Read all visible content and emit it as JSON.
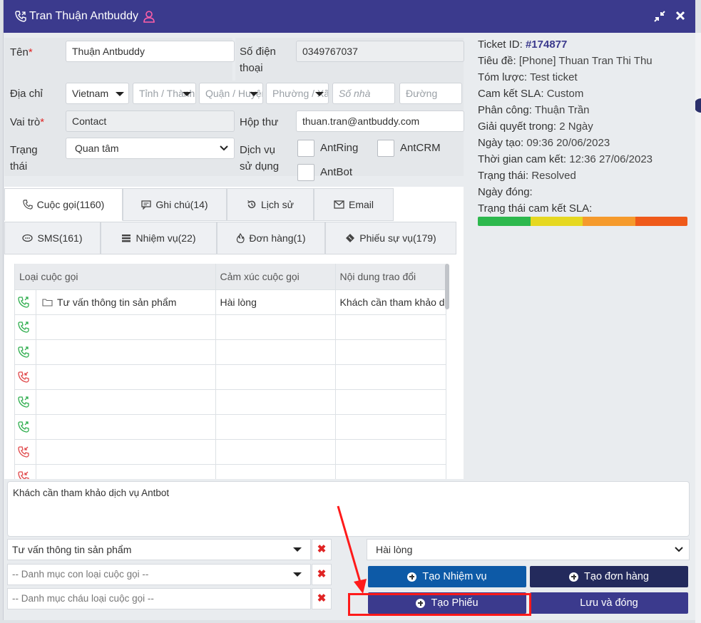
{
  "window": {
    "title": "Tran Thuận Antbuddy",
    "phone_icon": "phone-icon",
    "user_icon": "user-icon",
    "minimize_icon": "compress-icon",
    "close_icon": "close-icon"
  },
  "form": {
    "name_label": "Tên",
    "name_value": "Thuận  Antbuddy",
    "phone_label": "Số điện thoại",
    "phone_value": "0349767037",
    "address_label": "Địa chỉ",
    "country_value": "Vietnam",
    "province_placeholder": "Tỉnh / Thành phố",
    "district_placeholder": "Quận / Huyện",
    "ward_placeholder": "Phường / Xã",
    "house_placeholder": "Số nhà",
    "street_placeholder": "Đường",
    "role_label": "Vai trò",
    "role_value": "Contact",
    "mailbox_label": "Hộp thư",
    "mailbox_value": "thuan.tran@antbuddy.com",
    "status_label": "Trạng thái",
    "status_value": "Quan tâm",
    "services_label": "Dịch vụ sử dụng",
    "services": [
      "AntRing",
      "AntCRM",
      "AntBot"
    ]
  },
  "tabs_row1": [
    {
      "label": "Cuộc gọi(1160)",
      "icon": "phone-icon"
    },
    {
      "label": "Ghi chú(14)",
      "icon": "comment-icon"
    },
    {
      "label": "Lịch sử",
      "icon": "history-icon"
    },
    {
      "label": "Email",
      "icon": "envelope-icon"
    }
  ],
  "tabs_row2": [
    {
      "label": "SMS(161)",
      "icon": "chat-icon"
    },
    {
      "label": "Nhiệm vụ(22)",
      "icon": "tasks-icon"
    },
    {
      "label": "Đơn hàng(1)",
      "icon": "fire-icon"
    },
    {
      "label": "Phiếu sự vụ(179)",
      "icon": "ticket-icon"
    }
  ],
  "calls_table": {
    "headers": [
      "Loại cuộc gọi",
      "Cảm xúc cuộc gọi",
      "Nội dung trao đổi"
    ],
    "rows": [
      {
        "direction": "outgoing",
        "type": "Tư vấn thông tin sản phẩm",
        "emotion": "Hài lòng",
        "content": "Khách cần tham khảo dịch vụ Antbot"
      },
      {
        "direction": "outgoing",
        "type": "",
        "emotion": "",
        "content": ""
      },
      {
        "direction": "outgoing",
        "type": "",
        "emotion": "",
        "content": ""
      },
      {
        "direction": "missed",
        "type": "",
        "emotion": "",
        "content": ""
      },
      {
        "direction": "outgoing",
        "type": "",
        "emotion": "",
        "content": ""
      },
      {
        "direction": "outgoing",
        "type": "",
        "emotion": "",
        "content": ""
      },
      {
        "direction": "missed",
        "type": "",
        "emotion": "",
        "content": ""
      },
      {
        "direction": "missed",
        "type": "",
        "emotion": "",
        "content": ""
      }
    ]
  },
  "content_text": "Khách cần tham khảo dịch vụ Antbot",
  "selects": {
    "call_type": "Tư vấn thông tin sản phẩm",
    "sub_category": "-- Danh mục con loại cuộc gọi --",
    "grand_category": "-- Danh mục cháu loại cuộc gọi --",
    "emotion": "Hài lòng"
  },
  "buttons": {
    "create_task": "Tạo Nhiệm vụ",
    "create_order": "Tạo đơn hàng",
    "create_ticket": "Tạo Phiếu",
    "save_close": "Lưu và đóng"
  },
  "ticket_info": {
    "ticket_id_label": "Ticket ID:",
    "ticket_id": "#174877",
    "title_label": "Tiêu đề:",
    "title": "[Phone] Thuan Tran Thi Thu",
    "summary_label": "Tóm lược:",
    "summary": "Test ticket",
    "sla_label": "Cam kết SLA:",
    "sla": "Custom",
    "assignee_label": "Phân công:",
    "assignee": "Thuận Trần",
    "resolve_label": "Giải quyết trong:",
    "resolve": "2 Ngày",
    "created_label": "Ngày tạo:",
    "created": "09:36 20/06/2023",
    "commit_label": "Thời gian cam kết:",
    "commit": "12:36 27/06/2023",
    "status_label": "Trạng thái:",
    "status": "Resolved",
    "closed_label": "Ngày đóng:",
    "closed": "",
    "sla_status_label": "Trạng thái cam kết SLA:"
  },
  "colors": {
    "header": "#3b3a8d",
    "btn_task": "#0d5aa7",
    "btn_order": "#232a5c",
    "btn_ticket": "#3b3a8d",
    "btn_save": "#3b3a8d",
    "sla": [
      "#2db84d",
      "#e6d820",
      "#f59a2c",
      "#ef5a1a"
    ],
    "call_outgoing": "#2fae4e",
    "call_missed": "#e0484a",
    "annotation": "#ff1a1a"
  }
}
